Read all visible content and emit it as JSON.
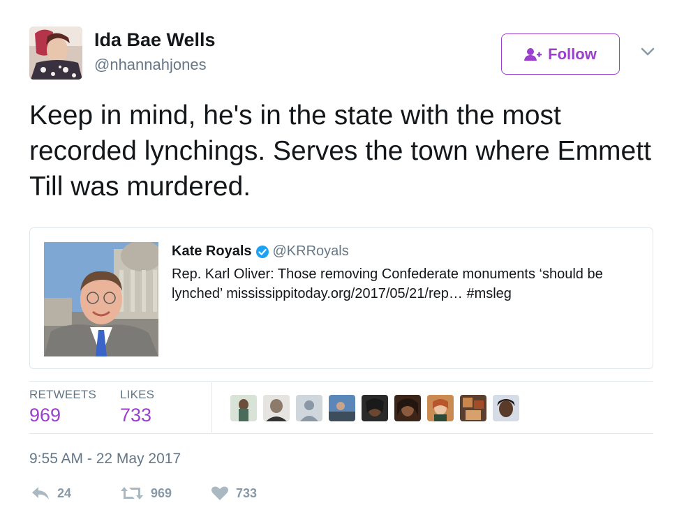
{
  "author": {
    "display_name": "Ida Bae Wells",
    "handle": "@nhannahjones",
    "avatar": "avatar-photo"
  },
  "follow_button": {
    "label": "Follow",
    "icon": "follow-user-icon",
    "color": "#9b3fcf"
  },
  "menu": {
    "icon": "chevron-down-icon"
  },
  "tweet": {
    "text": "Keep in mind, he's in the state with the most recorded lynchings. Serves the town where Emmett Till was murdered."
  },
  "quoted_tweet": {
    "name": "Kate Royals",
    "verified_icon": "verified-badge-icon",
    "handle": "@KRRoyals",
    "text": "Rep. Karl Oliver: Those removing Confederate monuments ‘should be lynched’ mississippitoday.org/2017/05/21/rep… #msleg",
    "photo": "portrait-photo"
  },
  "stats": {
    "retweets_label": "RETWEETS",
    "retweets_count": "969",
    "likes_label": "LIKES",
    "likes_count": "733"
  },
  "likers": [
    {
      "name": "liker-avatar-1"
    },
    {
      "name": "liker-avatar-2"
    },
    {
      "name": "liker-avatar-3"
    },
    {
      "name": "liker-avatar-4"
    },
    {
      "name": "liker-avatar-5"
    },
    {
      "name": "liker-avatar-6"
    },
    {
      "name": "liker-avatar-7"
    },
    {
      "name": "liker-avatar-8"
    },
    {
      "name": "liker-avatar-9"
    }
  ],
  "timestamp": "9:55 AM - 22 May 2017",
  "actions": {
    "reply_count": "24",
    "retweet_count": "969",
    "like_count": "733"
  },
  "colors": {
    "accent": "#9b3fcf",
    "text": "#14171a",
    "muted": "#657786",
    "border": "#e1e8ed",
    "verified": "#1da1f2",
    "action_icon": "#aab8c2"
  }
}
